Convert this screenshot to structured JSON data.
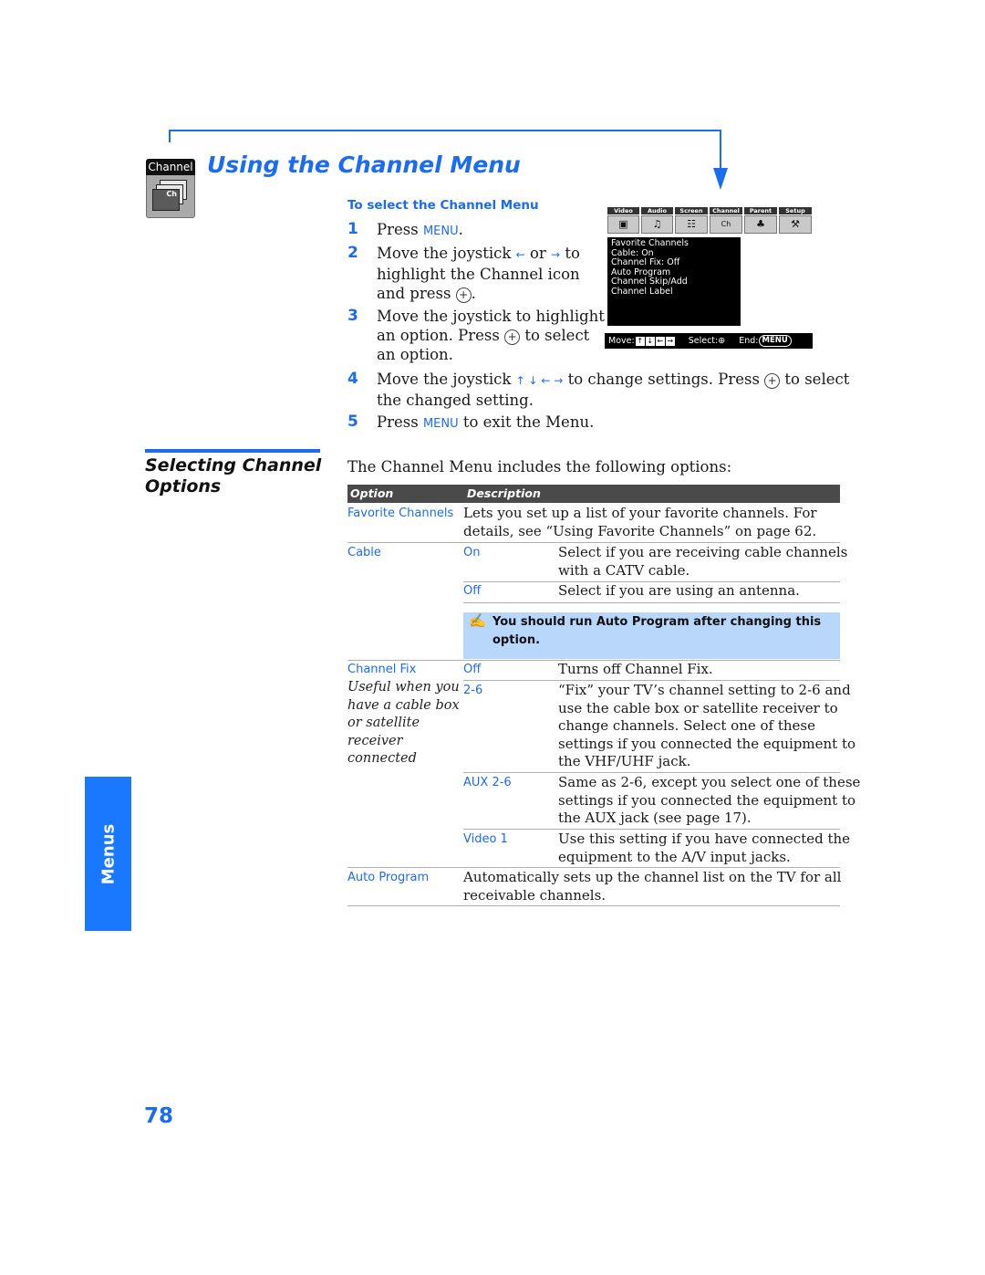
{
  "header": {
    "icon_label": "Channel",
    "icon_inner": "Ch",
    "title": "Using the Channel Menu"
  },
  "procedure": {
    "heading": "To select the Channel Menu",
    "steps": [
      {
        "num": "1",
        "pre": "Press ",
        "kw": "MENU",
        "post": "."
      },
      {
        "num": "2",
        "line1a": "Move the joystick ",
        "arrow_left": "←",
        "or": " or ",
        "arrow_right": "→",
        "line1b": " to",
        "line2": "highlight the Channel icon",
        "line3a": "and press ",
        "line3b": "."
      },
      {
        "num": "3",
        "line1": "Move the joystick to highlight",
        "line2a": "an option. Press ",
        "line2b": " to select",
        "line3": "an option."
      },
      {
        "num": "4",
        "line1a": "Move the joystick ",
        "arrows": "↑ ↓ ← →",
        "line1b": " to change settings. Press ",
        "line1c": " to select",
        "line2": "the changed setting."
      },
      {
        "num": "5",
        "pre": "Press ",
        "kw": "MENU",
        "post": " to exit the Menu."
      }
    ],
    "plus_symbol": "+"
  },
  "tv_menu": {
    "tabs": [
      "Video",
      "Audio",
      "Screen",
      "Channel",
      "Parent",
      "Setup"
    ],
    "tab_icons": [
      "▣",
      "♫",
      "☷",
      "Ch",
      "♣",
      "⚒"
    ],
    "items": [
      "Favorite Channels",
      "Cable: On",
      "Channel Fix: Off",
      "Auto Program",
      "Channel Skip/Add",
      "Channel Label"
    ],
    "bar": {
      "move": "Move:",
      "keys": [
        "↑",
        "↓",
        "←",
        "→"
      ],
      "select": "Select:",
      "select_sym": "⊕",
      "end": "End:",
      "end_btn": "MENU"
    }
  },
  "section": {
    "heading_line1": "Selecting Channel",
    "heading_line2": "Options",
    "intro": "The Channel Menu includes the following options:"
  },
  "table": {
    "headers": [
      "Option",
      "Description"
    ],
    "favorite": {
      "option": "Favorite Channels",
      "desc1": "Lets you set up a list of your favorite channels. For",
      "desc2": "details, see “Using Favorite Channels” on page 62."
    },
    "cable": {
      "option": "Cable",
      "on": {
        "value": "On",
        "desc1": "Select if you are receiving cable channels",
        "desc2": "with a CATV cable."
      },
      "off": {
        "value": "Off",
        "desc1": "Select if you are using an antenna."
      },
      "note1": "You should run Auto Program after changing this",
      "note2": "option.",
      "note_icon": "✍"
    },
    "channel_fix": {
      "option": "Channel Fix",
      "note_lines": [
        "Useful when you",
        "have a cable box",
        "or satellite",
        "receiver",
        "connected"
      ],
      "off": {
        "value": "Off",
        "desc1": "Turns off Channel Fix."
      },
      "v26": {
        "value": "2-6",
        "desc": [
          "“Fix” your TV’s channel setting to 2-6 and",
          "use the cable box or satellite receiver to",
          "change channels. Select one of these",
          "settings if you connected the equipment to",
          "the VHF/UHF jack."
        ]
      },
      "aux": {
        "value": "AUX 2-6",
        "desc": [
          "Same as 2-6, except you select one of these",
          "settings if you connected the equipment to",
          "the AUX jack (see page 17)."
        ]
      },
      "video1": {
        "value": "Video 1",
        "desc": [
          "Use this setting if you have connected the",
          "equipment to the A/V input jacks."
        ]
      }
    },
    "auto_program": {
      "option": "Auto Program",
      "desc1": "Automatically sets up the channel list on the TV for all",
      "desc2": "receivable channels."
    }
  },
  "side_tab": "Menus",
  "page_number": "78"
}
